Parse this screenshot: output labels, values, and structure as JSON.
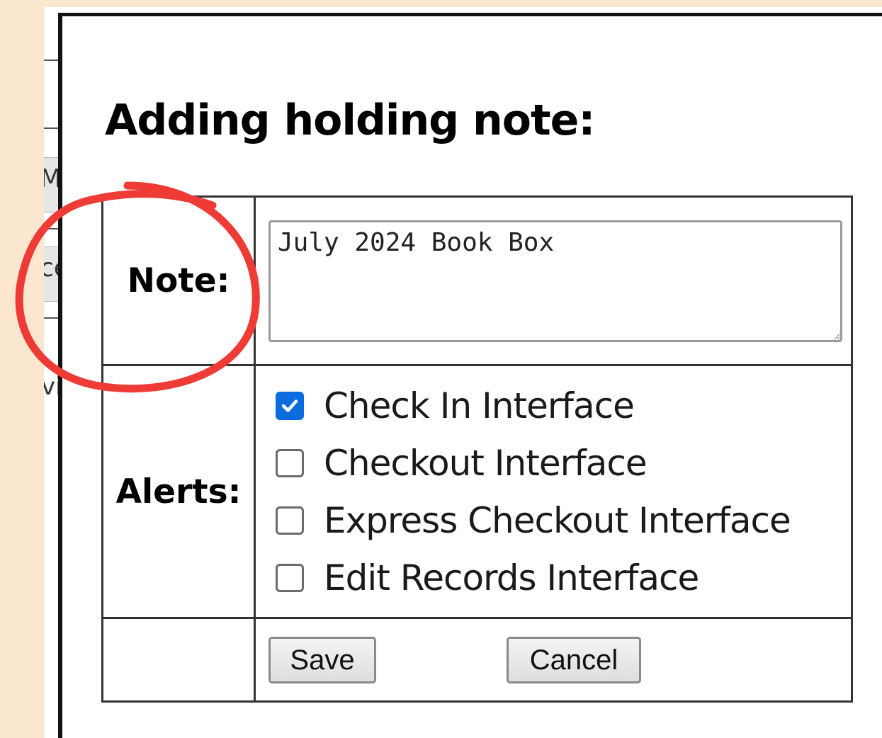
{
  "dialog": {
    "title": "Adding holding note:",
    "note_label": "Note:",
    "note_value": "July 2024 Book Box",
    "alerts_label": "Alerts:",
    "alerts": [
      {
        "label": "Check In Interface",
        "checked": true
      },
      {
        "label": "Checkout Interface",
        "checked": false
      },
      {
        "label": "Express Checkout Interface",
        "checked": false
      },
      {
        "label": "Edit Records Interface",
        "checked": false
      }
    ],
    "save_label": "Save",
    "cancel_label": "Cancel"
  },
  "background": {
    "fragments": [
      "M",
      "ce",
      "vi"
    ]
  },
  "colors": {
    "page_background": "#fbe7cf",
    "annotation": "#ef3b35",
    "checkbox_accent": "#0a6cde"
  },
  "icons": {
    "checkmark": "checkmark-icon",
    "resize_handle": "resize-grip-icon"
  }
}
